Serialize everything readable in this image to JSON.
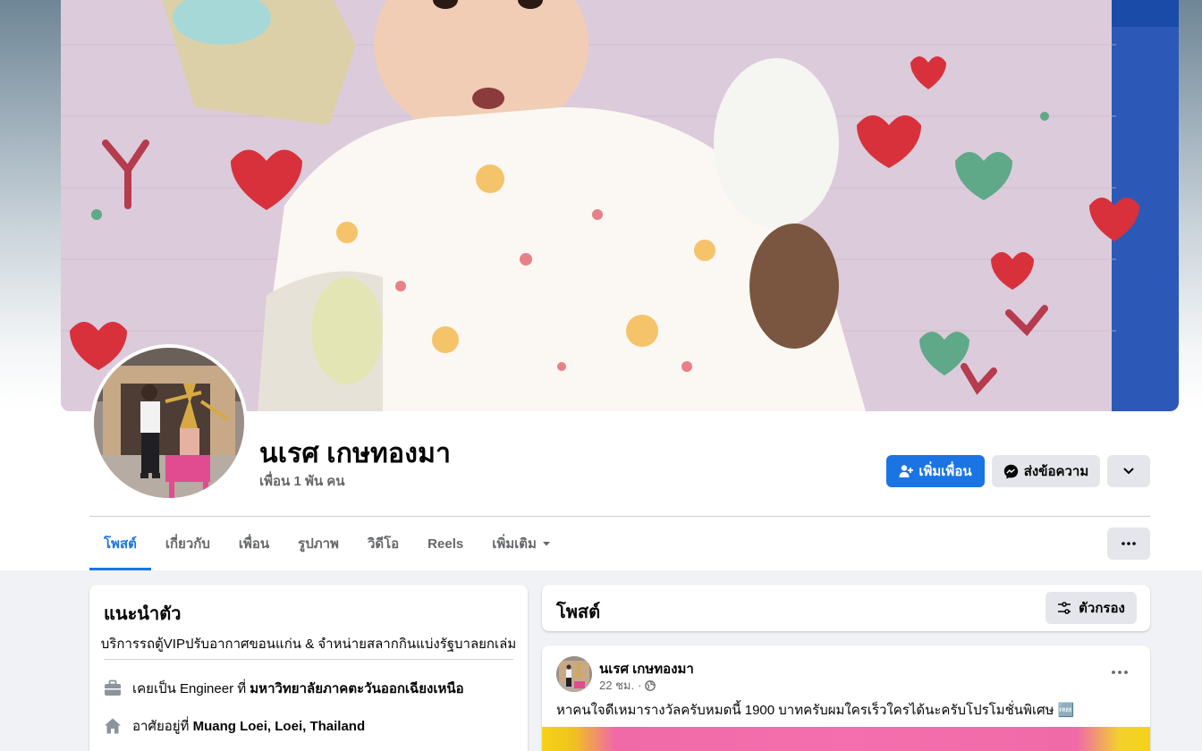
{
  "profile": {
    "name": "นเรศ เกษทองมา",
    "friends": "เพื่อน 1 พัน คน"
  },
  "actions": {
    "add_friend": "เพิ่มเพื่อน",
    "message": "ส่งข้อความ"
  },
  "tabs": [
    {
      "label": "โพสต์",
      "active": true
    },
    {
      "label": "เกี่ยวกับ"
    },
    {
      "label": "เพื่อน"
    },
    {
      "label": "รูปภาพ"
    },
    {
      "label": "วิดีโอ"
    },
    {
      "label": "Reels"
    },
    {
      "label": "เพิ่มเติม"
    }
  ],
  "intro": {
    "title": "แนะนำตัว",
    "bio": "บริการรถตู้VIPปรับอากาศขอนแก่น & จำหน่ายสลากกินแบ่งรัฐบาลยกเล่ม",
    "work_prefix": "เคยเป็น Engineer ที่ ",
    "work_place": "มหาวิทยาลัยภาคตะวันออกเฉียงเหนือ",
    "lives_prefix": "อาศัยอยู่ที่ ",
    "lives_place": "Muang Loei, Loei, Thailand"
  },
  "posts": {
    "title": "โพสต์",
    "filter_label": "ตัวกรอง"
  },
  "post": {
    "author": "นเรศ เกษทองมา",
    "time": "22 ชม.",
    "separator": "·",
    "text": "หาคนใจดีเหมารางวัลครับหมดนี้ 1900 บาทครับผมใครเร็วใครได้นะครับโปรโมชั่นพิเศษ 🆓"
  },
  "colors": {
    "primary": "#1b74e4",
    "secondary_btn": "#e4e6eb",
    "page_bg": "#f0f2f5",
    "muted_text": "#65676b"
  }
}
